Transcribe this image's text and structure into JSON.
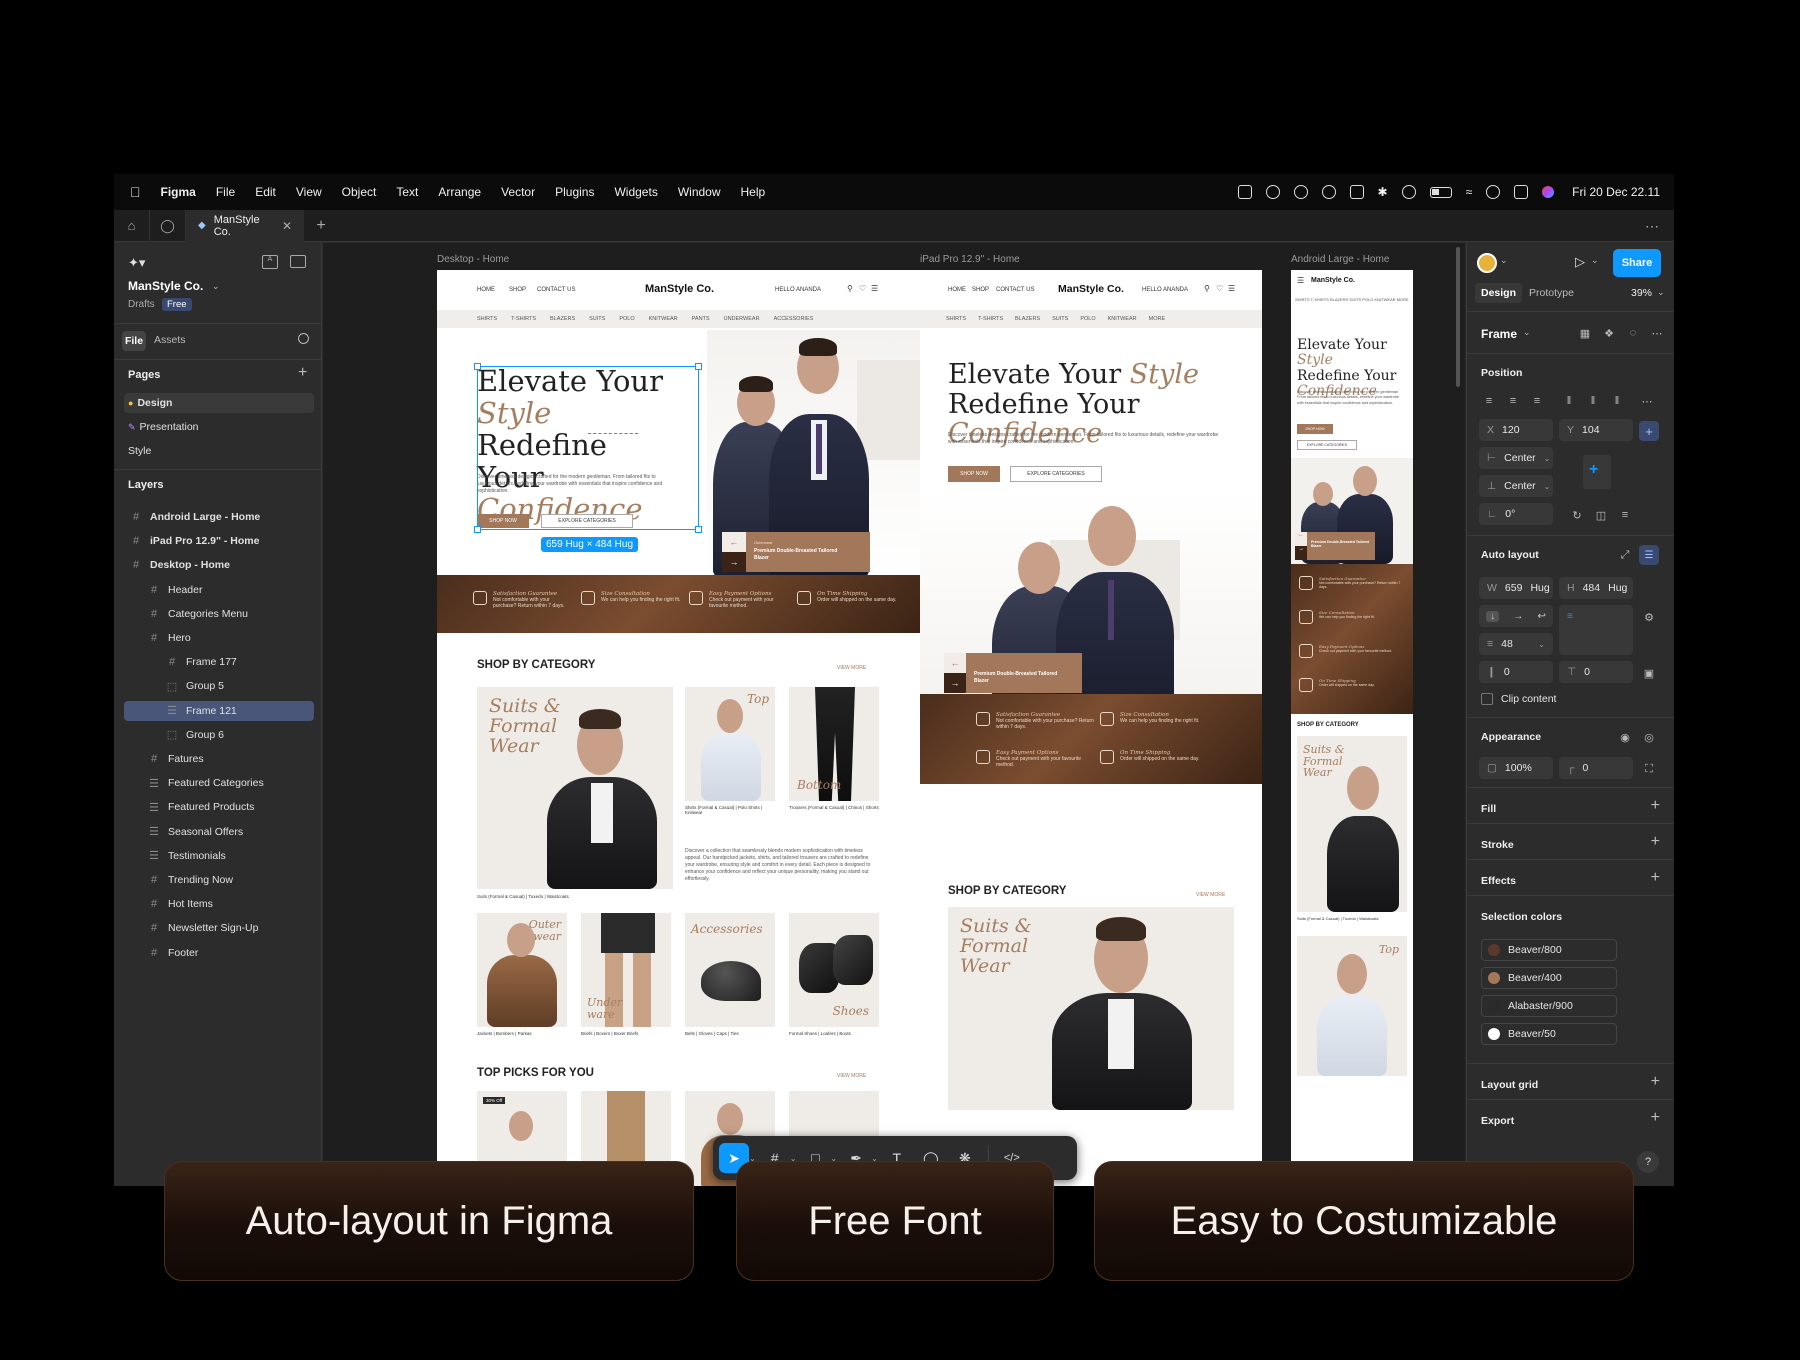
{
  "menubar": {
    "app": "Figma",
    "items": [
      "File",
      "Edit",
      "View",
      "Object",
      "Text",
      "Arrange",
      "Vector",
      "Plugins",
      "Widgets",
      "Window",
      "Help"
    ],
    "clock": "Fri 20 Dec  22.11"
  },
  "tabs": {
    "active_file": "ManStyle Co."
  },
  "left_panel": {
    "file_name": "ManStyle Co.",
    "drafts": "Drafts",
    "plan_badge": "Free",
    "tab_file": "File",
    "tab_assets": "Assets",
    "pages_title": "Pages",
    "pages": [
      "Design",
      "Presentation",
      "Style"
    ],
    "layers_title": "Layers",
    "layers": [
      {
        "name": "Android Large - Home",
        "indent": 0,
        "bold": true,
        "icon": "frame-icon"
      },
      {
        "name": "iPad Pro 12.9\" - Home",
        "indent": 0,
        "bold": true,
        "icon": "frame-icon"
      },
      {
        "name": "Desktop - Home",
        "indent": 0,
        "bold": true,
        "icon": "frame-icon"
      },
      {
        "name": "Header",
        "indent": 1,
        "icon": "frame-icon"
      },
      {
        "name": "Categories Menu",
        "indent": 1,
        "icon": "frame-icon"
      },
      {
        "name": "Hero",
        "indent": 1,
        "icon": "frame-icon"
      },
      {
        "name": "Frame 177",
        "indent": 2,
        "icon": "frame-icon"
      },
      {
        "name": "Group 5",
        "indent": 2,
        "icon": "group-icon"
      },
      {
        "name": "Frame 121",
        "indent": 2,
        "icon": "autolayout-icon",
        "selected": true
      },
      {
        "name": "Group 6",
        "indent": 2,
        "icon": "group-icon"
      },
      {
        "name": "Fatures",
        "indent": 1,
        "icon": "frame-icon"
      },
      {
        "name": "Featured Categories",
        "indent": 1,
        "icon": "autolayout-icon"
      },
      {
        "name": "Featured Products",
        "indent": 1,
        "icon": "autolayout-icon"
      },
      {
        "name": "Seasonal Offers",
        "indent": 1,
        "icon": "autolayout-icon"
      },
      {
        "name": "Testimonials",
        "indent": 1,
        "icon": "autolayout-icon"
      },
      {
        "name": "Trending Now",
        "indent": 1,
        "icon": "frame-icon"
      },
      {
        "name": "Hot Items",
        "indent": 1,
        "icon": "frame-icon"
      },
      {
        "name": "Newsletter Sign-Up",
        "indent": 1,
        "icon": "frame-icon"
      },
      {
        "name": "Footer",
        "indent": 1,
        "icon": "frame-icon"
      }
    ]
  },
  "canvas": {
    "frame_labels": [
      "Desktop - Home",
      "iPad Pro 12.9\" - Home",
      "Android Large - Home"
    ],
    "selection_badge": "659 Hug × 484 Hug",
    "site": {
      "logo": "ManStyle Co.",
      "nav_links": [
        "HOME",
        "SHOP",
        "CONTACT US"
      ],
      "hello": "HELLO ANANDA",
      "categories": [
        "SHIRTS",
        "T-SHIRTS",
        "BLAZERS",
        "SUITS",
        "POLO",
        "KNITWEAR",
        "PANTS",
        "UNDERWEAR",
        "ACCESSORIES"
      ],
      "ipad_categories": [
        "SHIRTS",
        "T-SHIRTS",
        "BLAZERS",
        "SUITS",
        "POLO",
        "KNITWEAR",
        "MORE"
      ],
      "hero_line1": "Elevate Your",
      "hero_italic1": "Style",
      "hero_line2": "Redefine Your",
      "hero_italic2": "Confidence",
      "hero_text": "Discover timeless designs crafted for the modern gentleman. From tailored fits to luxurious details, redefine your wardrobe with essentials that inspire confidence and sophistication.",
      "shop_now": "SHOP NOW",
      "explore": "EXPLORE CATEGORIES",
      "product_tag_small": "Outerwear",
      "product_tag": "Premium Double-Breasted Tailored Blazer",
      "features": [
        {
          "title": "Satisfaction Guarantee",
          "text": "Not comfortable with your purchase? Return within 7 days."
        },
        {
          "title": "Size Consultation",
          "text": "We can help you finding the right fit."
        },
        {
          "title": "Easy Payment Options",
          "text": "Check out payment with your favourite method."
        },
        {
          "title": "On Time Shipping",
          "text": "Order will shipped on the same day."
        }
      ],
      "shop_by_category": "SHOP BY CATEGORY",
      "view_more": "VIEW MORE",
      "category_cards": [
        "Suits & Formal Wear",
        "Top",
        "Bottom",
        "Outer wear",
        "Under ware",
        "Accessories",
        "Shoes"
      ],
      "cat_subs": [
        "Suits (Formal & Casual) | Tuxedo | Waistcoats",
        "Shirts (Formal & Casual) | Polo Shirts | Knitwear",
        "Trousers (Formal & Casual) | Chinos | Shorts",
        "Jackets | Bombers | Parkas",
        "Briefs | Boxers | Boxer Briefs",
        "Belts | Gloves | Caps | Ties",
        "Formal Shoes | Loafers | Boots"
      ],
      "category_desc": "Discover a collection that seamlessly blends modern sophistication with timeless appeal. Our handpicked jackets, shirts, and tailored trousers are crafted to redefine your wardrobe, ensuring style and comfort in every detail. Each piece is designed to enhance your confidence and reflect your unique personality, making you stand out effortlessly.",
      "top_picks": "TOP PICKS FOR YOU",
      "sale_badge": "30% Off"
    }
  },
  "right_panel": {
    "tab_design": "Design",
    "tab_prototype": "Prototype",
    "zoom": "39%",
    "share": "Share",
    "frame_title": "Frame",
    "position": "Position",
    "x_label": "X",
    "x": "120",
    "y_label": "Y",
    "y": "104",
    "h_constraint": "Center",
    "v_constraint": "Center",
    "rotation": "0°",
    "auto_layout": "Auto layout",
    "w_label": "W",
    "w": "659",
    "w_mode": "Hug",
    "h_label": "H",
    "h": "484",
    "h_mode": "Hug",
    "gap": "48",
    "padding_h": "0",
    "padding_v": "0",
    "clip_content": "Clip content",
    "appearance": "Appearance",
    "opacity": "100%",
    "radius": "0",
    "fill": "Fill",
    "stroke": "Stroke",
    "effects": "Effects",
    "selection_colors": "Selection colors",
    "colors": [
      {
        "name": "Beaver/800",
        "hex": "#5b3a2c"
      },
      {
        "name": "Beaver/400",
        "hex": "#a2775a"
      },
      {
        "name": "Alabaster/900",
        "hex": "#2a2a2a"
      },
      {
        "name": "Beaver/50",
        "hex": "#ffffff"
      }
    ],
    "layout_grid": "Layout grid",
    "export": "Export",
    "help": "?"
  },
  "captions": [
    "Auto-layout in Figma",
    "Free Font",
    "Easy to Costumizable"
  ]
}
